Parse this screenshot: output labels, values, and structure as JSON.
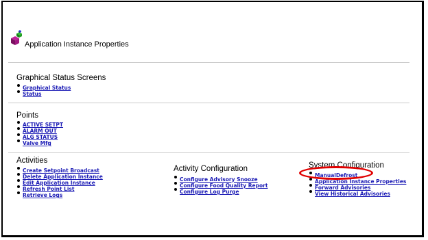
{
  "page": {
    "title": "Application Instance Properties"
  },
  "sections": {
    "graphical": {
      "title": "Graphical Status Screens",
      "links": [
        "Graphical Status",
        "Status"
      ]
    },
    "points": {
      "title": "Points",
      "links": [
        "ACTIVE SETPT",
        "ALARM OUT",
        "ALG STATUS",
        "Valve Mfg"
      ]
    },
    "activities": {
      "title": "Activities",
      "links": [
        "Create Setpoint Broadcast",
        "Delete Application Instance",
        "Edit Application Instance",
        "Refresh Point List",
        "Retrieve Logs"
      ]
    },
    "activity_config": {
      "title": "Activity Configuration",
      "links": [
        "Configure Advisory Snooze",
        "Configure Food Quality Report",
        "Configure Log Purge"
      ]
    },
    "system_config": {
      "title": "System Configuration",
      "links": [
        "ManualDefrost",
        "Application Instance Properties",
        "Forward Advisories",
        "View Historical Advisories"
      ]
    }
  },
  "annotation": {
    "highlight_color": "#e00000"
  },
  "colors": {
    "link": "#1a1ab5",
    "rule": "#c8c8c8"
  }
}
